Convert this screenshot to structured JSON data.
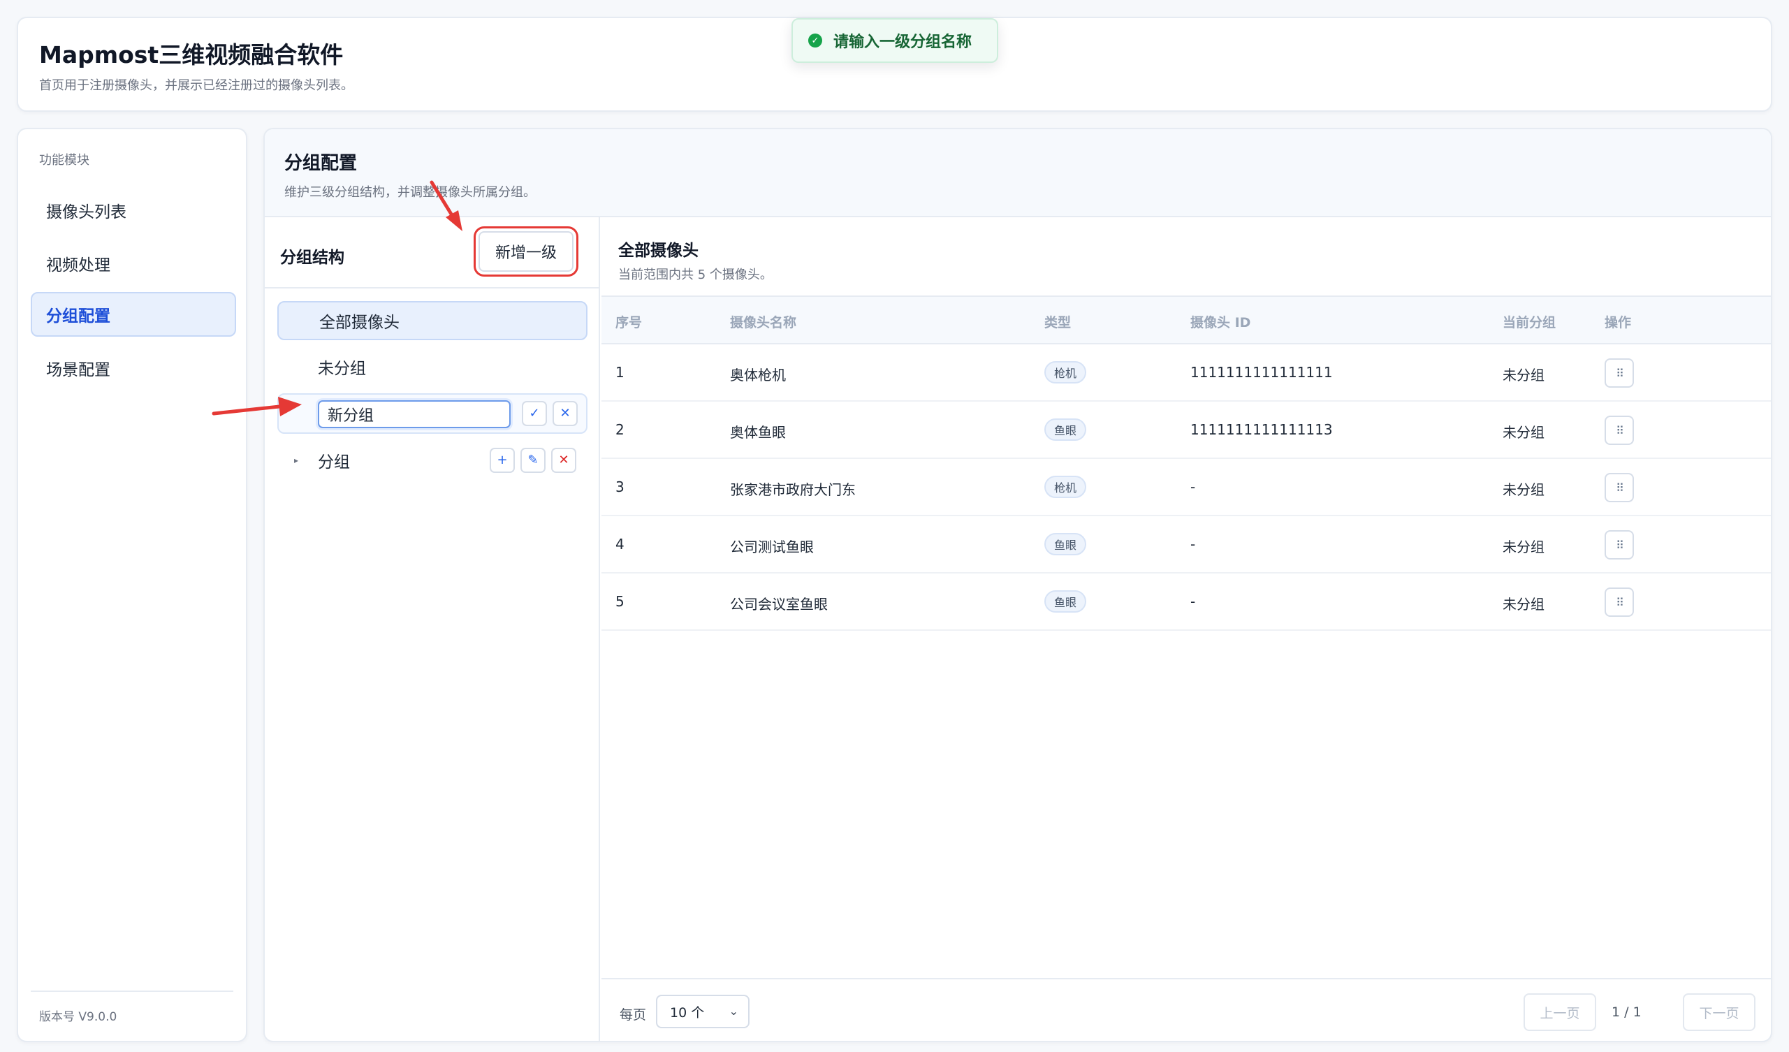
{
  "header": {
    "title": "Mapmost三维视频融合软件",
    "subtitle": "首页用于注册摄像头，并展示已经注册过的摄像头列表。"
  },
  "toast": {
    "message": "请输入一级分组名称",
    "icon": "check-circle-icon",
    "color": "#16a34a"
  },
  "sidebar": {
    "section_title": "功能模块",
    "items": [
      {
        "label": "摄像头列表",
        "active": false
      },
      {
        "label": "视频处理",
        "active": false
      },
      {
        "label": "分组配置",
        "active": true
      },
      {
        "label": "场景配置",
        "active": false
      }
    ],
    "version": "版本号 V9.0.0"
  },
  "main": {
    "title": "分组配置",
    "subtitle": "维护三级分组结构，并调整摄像头所属分组。"
  },
  "group_panel": {
    "title": "分组结构",
    "add_level1_label": "新增一级",
    "tree": {
      "all_label": "全部摄像头",
      "ungrouped_label": "未分组",
      "new_group_value": "新分组",
      "group_label": "分组"
    },
    "icons": {
      "confirm": "✓",
      "cancel": "✕",
      "add": "+",
      "edit": "✎",
      "delete": "✕"
    }
  },
  "camera_panel": {
    "title": "全部摄像头",
    "subtitle": "当前范围内共 5 个摄像头。",
    "columns": [
      "序号",
      "摄像头名称",
      "类型",
      "摄像头 ID",
      "当前分组",
      "操作"
    ],
    "rows": [
      {
        "index": "1",
        "name": "奥体枪机",
        "type": "枪机",
        "id": "1111111111111111",
        "group": "未分组"
      },
      {
        "index": "2",
        "name": "奥体鱼眼",
        "type": "鱼眼",
        "id": "1111111111111113",
        "group": "未分组"
      },
      {
        "index": "3",
        "name": "张家港市政府大门东",
        "type": "枪机",
        "id": "-",
        "group": "未分组"
      },
      {
        "index": "4",
        "name": "公司测试鱼眼",
        "type": "鱼眼",
        "id": "-",
        "group": "未分组"
      },
      {
        "index": "5",
        "name": "公司会议室鱼眼",
        "type": "鱼眼",
        "id": "-",
        "group": "未分组"
      }
    ]
  },
  "pagination": {
    "per_page_label": "每页",
    "page_size": "10 个",
    "prev_label": "上一页",
    "next_label": "下一页",
    "page_indicator": "1 / 1"
  },
  "colors": {
    "accent": "#1d4ed8",
    "highlight": "#e53935",
    "active_bg": "#e8f0fd"
  }
}
